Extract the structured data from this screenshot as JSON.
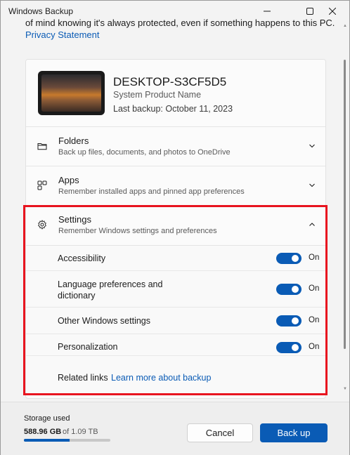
{
  "window": {
    "title": "Windows Backup"
  },
  "intro": {
    "text": "of mind knowing it's always protected, even if something happens to this PC.",
    "privacy_link": "Privacy Statement"
  },
  "device": {
    "name": "DESKTOP-S3CF5D5",
    "model": "System Product Name",
    "last_backup": "Last backup: October 11, 2023"
  },
  "sections": [
    {
      "title": "Folders",
      "description": "Back up files, documents, and photos to OneDrive",
      "icon": "folder-icon",
      "expanded": false
    },
    {
      "title": "Apps",
      "description": "Remember installed apps and pinned app preferences",
      "icon": "apps-icon",
      "expanded": false
    },
    {
      "title": "Settings",
      "description": "Remember Windows settings and preferences",
      "icon": "gear-icon",
      "expanded": true
    }
  ],
  "settings_items": [
    {
      "label": "Accessibility",
      "state": "On",
      "enabled": true
    },
    {
      "label": "Language preferences and\ndictionary",
      "label_line1": "Language preferences and",
      "label_line2": "dictionary",
      "state": "On",
      "enabled": true
    },
    {
      "label": "Other Windows settings",
      "state": "On",
      "enabled": true
    },
    {
      "label": "Personalization",
      "state": "On",
      "enabled": true
    }
  ],
  "related": {
    "label": "Related links",
    "link": "Learn more about backup"
  },
  "storage": {
    "label": "Storage used",
    "used": "588.96 GB",
    "total": "of 1.09 TB",
    "fraction": 0.53
  },
  "buttons": {
    "cancel": "Cancel",
    "backup": "Back up"
  },
  "colors": {
    "accent": "#0a5bb5",
    "highlight": "#e8141f"
  }
}
